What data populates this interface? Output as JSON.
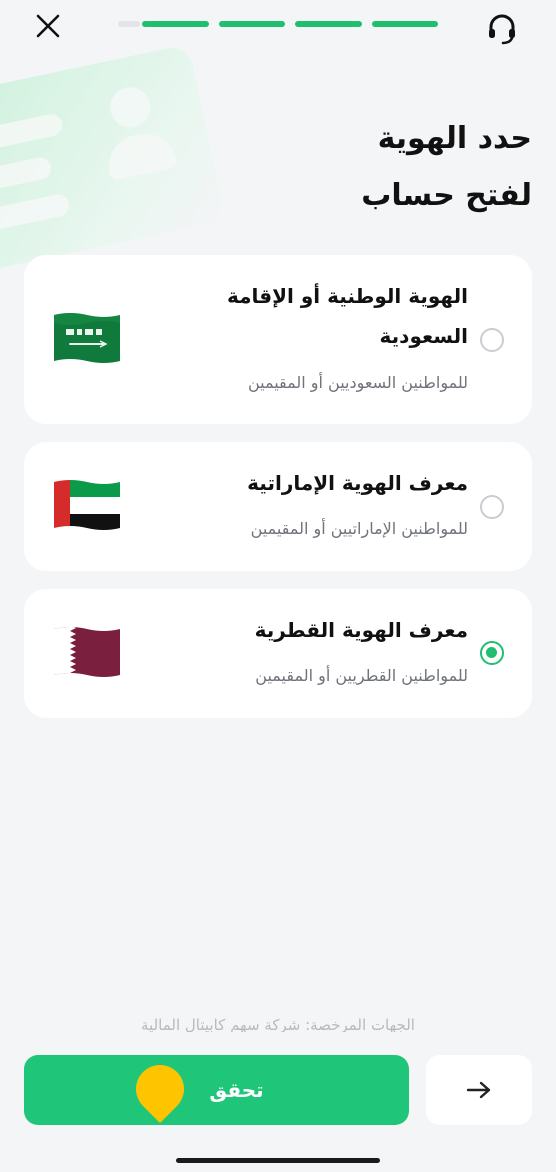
{
  "header": {
    "close_icon": "close-icon",
    "support_icon": "headset-icon",
    "progress": {
      "total_steps": 5,
      "completed_steps": 4
    }
  },
  "title": {
    "line1": "حدد الهوية",
    "line2": "لفتح حساب"
  },
  "options": [
    {
      "title_line1": "الهوية الوطنية أو الإقامة",
      "title_line2": "السعودية",
      "subtitle": "للمواطنين السعوديين أو المقيمين",
      "flag": "saudi-flag",
      "selected": false
    },
    {
      "title_line1": "معرف الهوية الإماراتية",
      "subtitle": "للمواطنين الإماراتيين أو المقيمين",
      "flag": "uae-flag",
      "selected": false
    },
    {
      "title_line1": "معرف الهوية القطرية",
      "subtitle": "للمواطنين القطريين أو المقيمين",
      "flag": "qatar-flag",
      "selected": true
    }
  ],
  "footer": {
    "disclaimer": "الجهات المرخصة: شركة سهم كابيتال المالية",
    "verify_label": "تحقق",
    "next_icon": "arrow-right-icon"
  },
  "colors": {
    "accent": "#1fc67a",
    "background": "#f4f5f7",
    "pin": "#ffc400"
  }
}
